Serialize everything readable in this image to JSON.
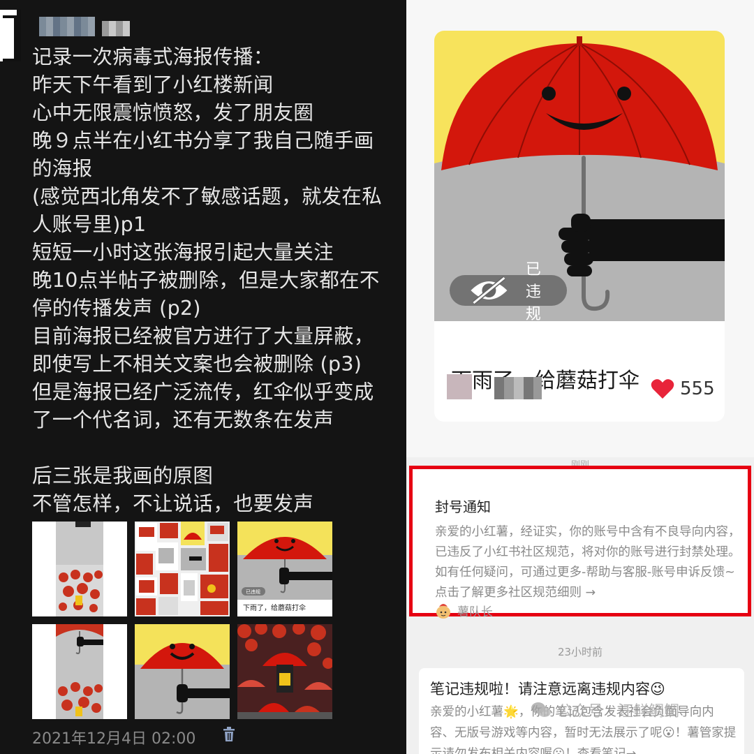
{
  "post": {
    "lines": [
      "记录一次病毒式海报传播：",
      "昨天下午看到了小红楼新闻",
      "心中无限震惊愤怒，发了朋友圈",
      "晚９点半在小红书分享了我自己随手画",
      "的海报",
      "(感觉西北角发不了敏感话题，就发在私",
      "人账号里)p1",
      "短短一小时这张海报引起大量关注",
      "晚10点半帖子被删除，但是大家都在不",
      "停的传播发声 (p2)",
      "目前海报已经被官方进行了大量屏蔽，",
      "即使写上不相关文案也会被删除 (p3)",
      "但是海报已经广泛流传，红伞似乎变成",
      "了一个代名词，还有无数条在发声",
      "",
      "后三张是我画的原图",
      "不管怎样，不让说话，也要发声"
    ],
    "timestamp": "2021年12月4日 02:00",
    "thumb_caption_badge": "已违规",
    "thumb_caption_title": "下雨了，给蘑菇打伞"
  },
  "card": {
    "badge": "已违规",
    "title": "下雨了，给蘑菇打伞",
    "likes": "555"
  },
  "notices": {
    "just_now": "刚刚",
    "ban": {
      "title": "封号通知",
      "body": "亲爱的小红薯，经证实，你的账号中含有不良导向内容，已违反了小红书社区规范，将对你的账号进行封禁处理。如有任何疑问，可通过更多-帮助与客服-账号申诉反馈~点击了解更多社区规范细则 →",
      "author": "薯队长"
    },
    "time_ago": "23小时前",
    "violation": {
      "title": "笔记违规啦！请注意远离违规内容😉",
      "body": "亲爱的小红薯🌟，你的笔记包含发表社会负面导向内容、无版号游戏等内容，暂时无法展示了呢😮！薯管家提示请勿发布相关内容喔😮！查看笔记→"
    },
    "watermark": "公众号 · 汪鲜鲷鲷"
  },
  "colors": {
    "umbrella_red": "#d3170c",
    "poster_yellow": "#f7e35c",
    "poster_gray": "#b4b4b4",
    "alert_red": "#e60012",
    "heart_red": "#e8243a"
  }
}
